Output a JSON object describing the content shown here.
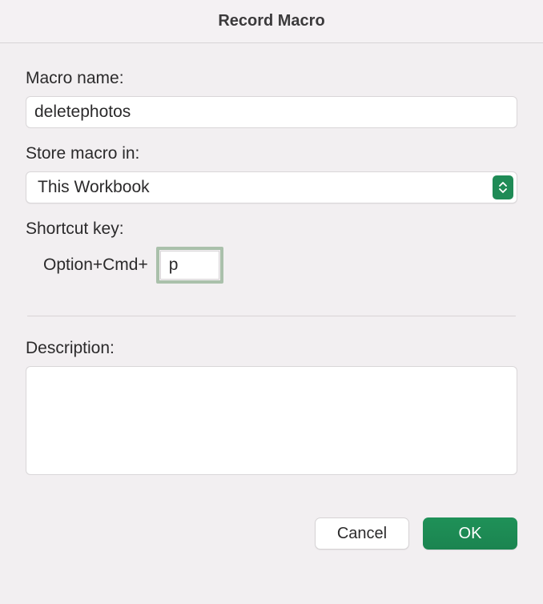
{
  "dialog": {
    "title": "Record Macro"
  },
  "fields": {
    "macro_name": {
      "label": "Macro name:",
      "value": "deletephotos"
    },
    "store_in": {
      "label": "Store macro in:",
      "selected": "This Workbook"
    },
    "shortcut": {
      "label": "Shortcut key:",
      "prefix": "Option+Cmd+",
      "value": "p"
    },
    "description": {
      "label": "Description:",
      "value": ""
    }
  },
  "buttons": {
    "cancel": "Cancel",
    "ok": "OK"
  },
  "colors": {
    "accent": "#1f8b56",
    "focus_ring": "#aac0ab"
  }
}
